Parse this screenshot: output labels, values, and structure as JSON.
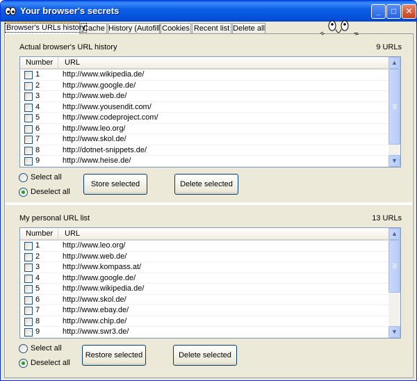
{
  "window": {
    "title": "Your browser's secrets",
    "icon": "app-eyes-icon",
    "controls": {
      "minimize": "minimize-icon",
      "maximize": "maximize-icon",
      "close": "close-icon"
    }
  },
  "tabs": [
    {
      "label": "Browser's URLs history",
      "active": true
    },
    {
      "label": "Cache"
    },
    {
      "label": "History (Autofill)"
    },
    {
      "label": "Cookies"
    },
    {
      "label": "Recent list"
    },
    {
      "label": "Delete all"
    }
  ],
  "history_section": {
    "title": "Actual browser's URL history",
    "count": "9 URLs",
    "columns": [
      "Number",
      "URL"
    ],
    "rows": [
      {
        "number": "1",
        "url": "http://www.wikipedia.de/"
      },
      {
        "number": "2",
        "url": "http://www.google.de/"
      },
      {
        "number": "3",
        "url": "http://www.web.de/"
      },
      {
        "number": "4",
        "url": "http://www.yousendit.com/"
      },
      {
        "number": "5",
        "url": "http://www.codeproject.com/"
      },
      {
        "number": "6",
        "url": "http://www.leo.org/"
      },
      {
        "number": "7",
        "url": "http://www.skol.de/"
      },
      {
        "number": "8",
        "url": "http://dotnet-snippets.de/"
      },
      {
        "number": "9",
        "url": "http://www.heise.de/"
      }
    ],
    "select_all": "Select all",
    "deselect_all": "Deselect all",
    "store_button": "Store selected",
    "delete_button": "Delete selected"
  },
  "personal_section": {
    "title": "My personal URL list",
    "count": "13 URLs",
    "columns": [
      "Number",
      "URL"
    ],
    "rows": [
      {
        "number": "1",
        "url": "http://www.leo.org/"
      },
      {
        "number": "2",
        "url": "http://www.web.de/"
      },
      {
        "number": "3",
        "url": "http://www.kompass.at/"
      },
      {
        "number": "4",
        "url": "http://www.google.de/"
      },
      {
        "number": "5",
        "url": "http://www.wikipedia.de/"
      },
      {
        "number": "6",
        "url": "http://www.skol.de/"
      },
      {
        "number": "7",
        "url": "http://www.ebay.de/"
      },
      {
        "number": "8",
        "url": "http://www.chip.de/"
      },
      {
        "number": "9",
        "url": "http://www.swr3.de/"
      }
    ],
    "select_all": "Select all",
    "deselect_all": "Deselect all",
    "restore_button": "Restore selected",
    "delete_button": "Delete selected"
  },
  "decoration": "peeking-eyes-icon"
}
